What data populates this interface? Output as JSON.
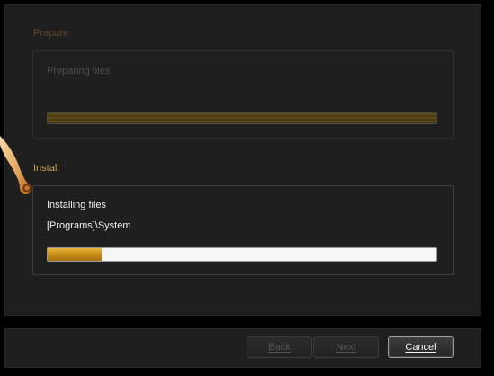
{
  "prepare": {
    "title": "Prepare",
    "status": "Preparing files",
    "progress_percent": 100
  },
  "install": {
    "title": "Install",
    "status": "Installing files",
    "current_path": "[Programs]\\System",
    "progress_percent": 14
  },
  "buttons": {
    "back": "Back",
    "next": "Next",
    "cancel": "Cancel"
  },
  "colors": {
    "accent": "#c9a055",
    "progress_fill": "#d49f24",
    "panel_bg": "#1f1f1f"
  }
}
